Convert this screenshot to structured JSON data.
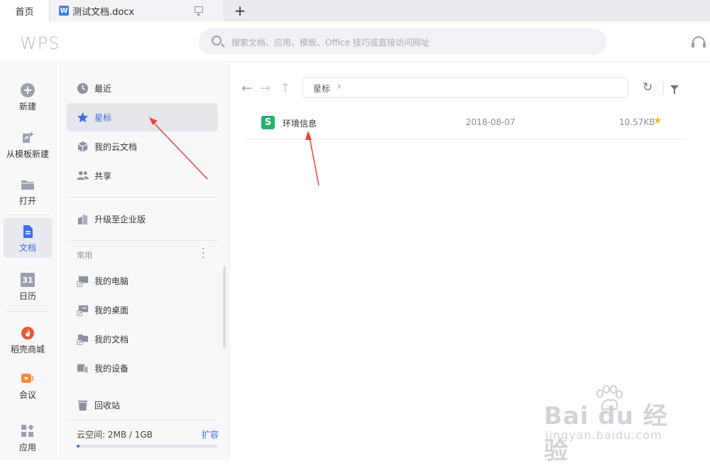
{
  "tabs": {
    "home_label": "首页",
    "doc_label": "测试文档.docx",
    "doc_icon_letter": "W",
    "add_label": "+"
  },
  "header": {
    "logo": "WPS",
    "search_placeholder": "搜索文档、应用、模板、Office 技巧或直接访问网址"
  },
  "nav": {
    "items": [
      {
        "label": "新建",
        "icon": "plus-circle-icon"
      },
      {
        "label": "从模板新建",
        "icon": "template-icon"
      },
      {
        "label": "打开",
        "icon": "folder-icon"
      },
      {
        "label": "文档",
        "icon": "document-icon"
      },
      {
        "label": "日历",
        "icon": "calendar-icon",
        "icon_text": "31"
      },
      {
        "label": "稻壳商城",
        "icon": "flame-icon"
      },
      {
        "label": "会议",
        "icon": "meeting-icon"
      },
      {
        "label": "应用",
        "icon": "apps-icon"
      }
    ],
    "active_index": 3
  },
  "panel": {
    "items": [
      {
        "label": "最近",
        "icon": "clock-icon"
      },
      {
        "label": "星标",
        "icon": "star-icon"
      },
      {
        "label": "我的云文档",
        "icon": "cloud-box-icon"
      },
      {
        "label": "共享",
        "icon": "people-icon"
      },
      {
        "label": "升级至企业版",
        "icon": "building-icon"
      }
    ],
    "active_index": 1,
    "common_label": "常用",
    "common_items": [
      {
        "label": "我的电脑",
        "icon": "computer-shortcut-icon"
      },
      {
        "label": "我的桌面",
        "icon": "desktop-shortcut-icon"
      },
      {
        "label": "我的文档",
        "icon": "folder-shortcut-icon"
      },
      {
        "label": "我的设备",
        "icon": "devices-icon"
      }
    ],
    "trash_label": "回收站",
    "cloud_space_label": "云空间: 2MB / 1GB",
    "expand_label": "扩容",
    "cloud_usage_fraction": 0.002
  },
  "main": {
    "breadcrumb": "星标",
    "breadcrumb_chevron": "›",
    "files": [
      {
        "name": "环境信息",
        "date": "2018-08-07",
        "size": "10.57KB",
        "starred": true,
        "icon_letter": "S"
      }
    ]
  },
  "watermark": {
    "main": "Bai du 经验",
    "sub": "jingyan.baidu.com"
  },
  "colors": {
    "accent": "#3f6fe0",
    "sheet_green": "#23b26d",
    "star": "#f3b814",
    "arrow": "#e8443a"
  }
}
